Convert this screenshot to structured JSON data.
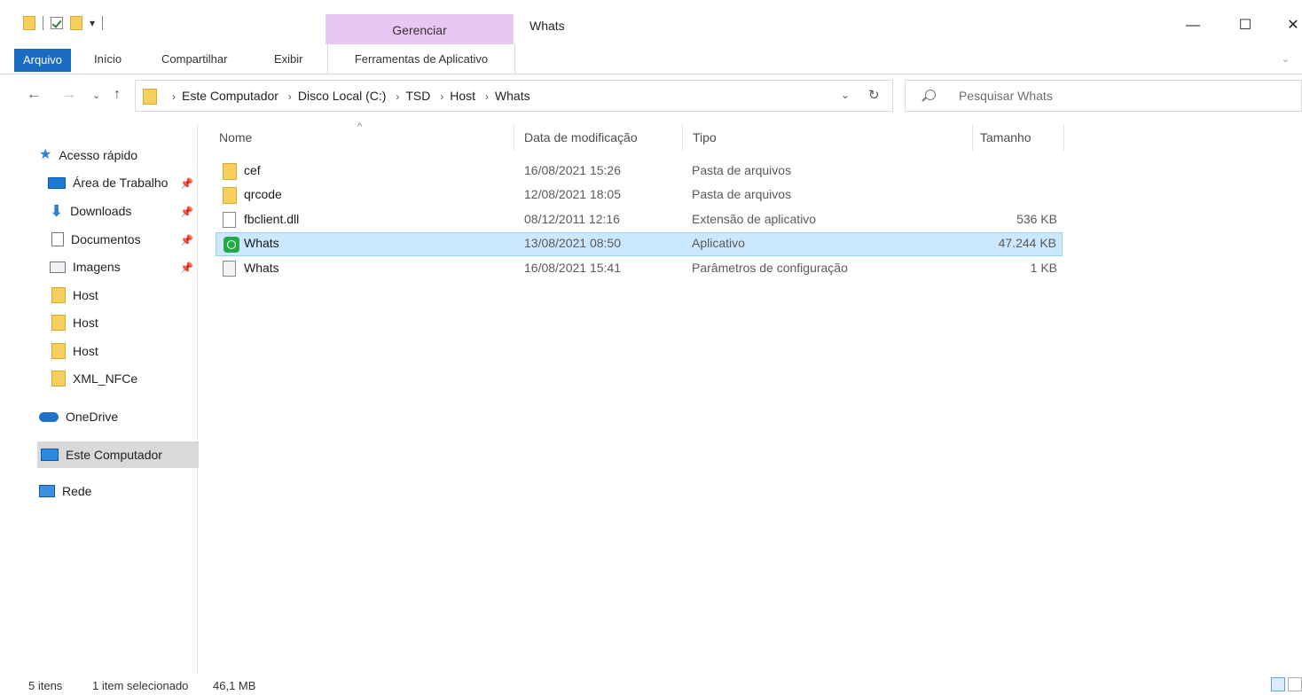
{
  "titlebar": {
    "context_tab": "Gerenciar",
    "window_title": "Whats",
    "minimize": "—",
    "maximize": "☐",
    "close": "✕"
  },
  "ribbon": {
    "tabs": [
      "Arquivo",
      "Início",
      "Compartilhar",
      "Exibir",
      "Ferramentas de Aplicativo"
    ],
    "collapse": "⌄"
  },
  "address": {
    "crumbs": [
      "Este Computador",
      "Disco Local (C:)",
      "TSD",
      "Host",
      "Whats"
    ]
  },
  "search": {
    "placeholder": "Pesquisar Whats"
  },
  "nav": {
    "items": [
      {
        "label": "Acesso rápido",
        "icon": "star-icon"
      },
      {
        "label": "Área de Trabalho",
        "icon": "desktop-icon",
        "pinned": true
      },
      {
        "label": "Downloads",
        "icon": "download-icon",
        "pinned": true
      },
      {
        "label": "Documentos",
        "icon": "document-icon",
        "pinned": true
      },
      {
        "label": "Imagens",
        "icon": "image-icon",
        "pinned": true
      },
      {
        "label": "Host",
        "icon": "folder-icon"
      },
      {
        "label": "Host",
        "icon": "folder-icon"
      },
      {
        "label": "Host",
        "icon": "folder-icon"
      },
      {
        "label": "XML_NFCe",
        "icon": "folder-icon"
      },
      {
        "label": "OneDrive",
        "icon": "cloud-icon"
      },
      {
        "label": "Este Computador",
        "icon": "computer-icon",
        "selected": true
      },
      {
        "label": "Rede",
        "icon": "network-icon"
      }
    ]
  },
  "list": {
    "columns": [
      "Nome",
      "Data de modificação",
      "Tipo",
      "Tamanho"
    ],
    "rows": [
      {
        "name": "cef",
        "date": "16/08/2021 15:26",
        "type": "Pasta de arquivos",
        "size": "",
        "icon": "folder-icon"
      },
      {
        "name": "qrcode",
        "date": "12/08/2021 18:05",
        "type": "Pasta de arquivos",
        "size": "",
        "icon": "folder-icon"
      },
      {
        "name": "fbclient.dll",
        "date": "08/12/2011 12:16",
        "type": "Extensão de aplicativo",
        "size": "536 KB",
        "icon": "dll-icon"
      },
      {
        "name": "Whats",
        "date": "13/08/2021 08:50",
        "type": "Aplicativo",
        "size": "47.244 KB",
        "icon": "whatsapp-icon",
        "selected": true
      },
      {
        "name": "Whats",
        "date": "16/08/2021 15:41",
        "type": "Parâmetros de configuração",
        "size": "1 KB",
        "icon": "config-icon"
      }
    ]
  },
  "status": {
    "count": "5 itens",
    "selection": "1 item selecionado",
    "size": "46,1 MB"
  }
}
